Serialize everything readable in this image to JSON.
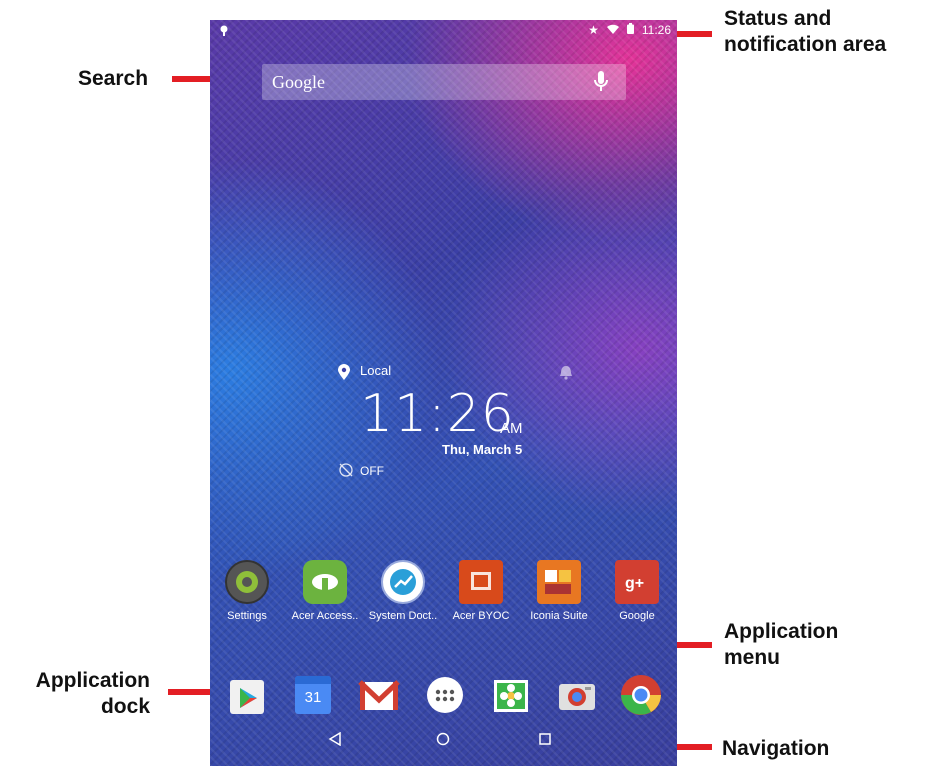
{
  "callouts": {
    "status": "Status and\nnotification area",
    "search": "Search",
    "app_menu": "Application\nmenu",
    "dock": "Application\ndock",
    "navigation": "Navigation"
  },
  "status_bar": {
    "time": "11:26"
  },
  "search": {
    "text": "Google"
  },
  "clock": {
    "location": "Local",
    "time": "11:26",
    "ampm": "AM",
    "date": "Thu, March 5",
    "alarm": "OFF"
  },
  "apps": [
    {
      "label": "Settings"
    },
    {
      "label": "Acer Access.."
    },
    {
      "label": "System Doct.."
    },
    {
      "label": "Acer BYOC"
    },
    {
      "label": "Iconia Suite"
    },
    {
      "label": "Google"
    }
  ],
  "dock": {
    "calendar_day": "31"
  },
  "icons": {
    "status": [
      "notification-icon",
      "star-icon",
      "wifi-icon",
      "battery-icon"
    ],
    "dock": [
      "play-store-icon",
      "calendar-icon",
      "gmail-icon",
      "app-menu-icon",
      "gallery-icon",
      "camera-icon",
      "chrome-icon"
    ],
    "navigation": [
      "back-icon",
      "home-icon",
      "recents-icon"
    ]
  },
  "colors": {
    "callout_line": "#e31e24"
  }
}
